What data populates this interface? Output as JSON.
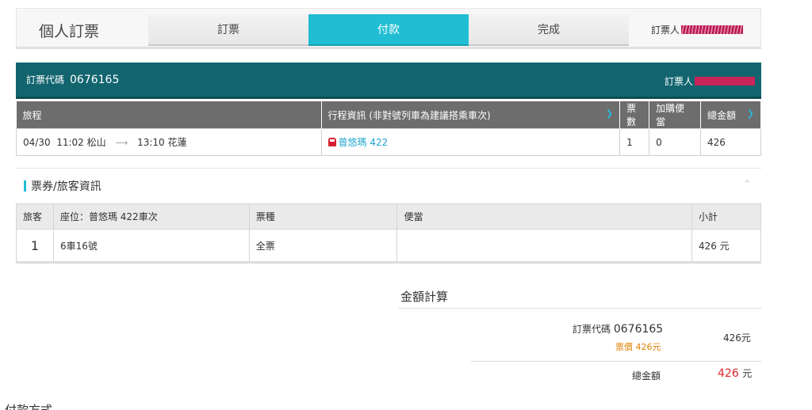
{
  "header": {
    "title": "個人訂票",
    "steps": [
      "訂票",
      "付款",
      "完成"
    ],
    "booker_label": "訂票人"
  },
  "booking": {
    "code_label": "訂票代碼",
    "code": "0676165",
    "booker_label": "訂票人",
    "columns": [
      "旅程",
      "行程資訊 (非對號列車為建議搭乘車次)",
      "票數",
      "加購便當",
      "總金額"
    ],
    "row": {
      "depart_date": "04/30",
      "depart_time": "11:02",
      "depart_station": "松山",
      "arrive_time": "13:10",
      "arrive_station": "花蓮",
      "train": "普悠瑪 422",
      "tickets": "1",
      "bento": "0",
      "total": "426"
    }
  },
  "tickets": {
    "section_title": "票券/旅客資訊",
    "columns": [
      "旅客",
      "座位：普悠瑪 422車次",
      "票種",
      "便當",
      "小計"
    ],
    "row": {
      "passenger": "1",
      "seat": "6車16號",
      "ticket_type": "全票",
      "bento": "",
      "subtotal": "426 元"
    }
  },
  "summary": {
    "title": "金額計算",
    "code_label": "訂票代碼",
    "code": "0676165",
    "fare": "票價 426元",
    "amount": "426元",
    "total_label": "總金額",
    "total_value": "426",
    "total_unit": "元"
  },
  "payment": {
    "title": "付款方式"
  },
  "colors": {
    "accent": "#20bdd3",
    "code_bar": "#12656f",
    "total": "#e0252c",
    "fare": "#e08000"
  }
}
